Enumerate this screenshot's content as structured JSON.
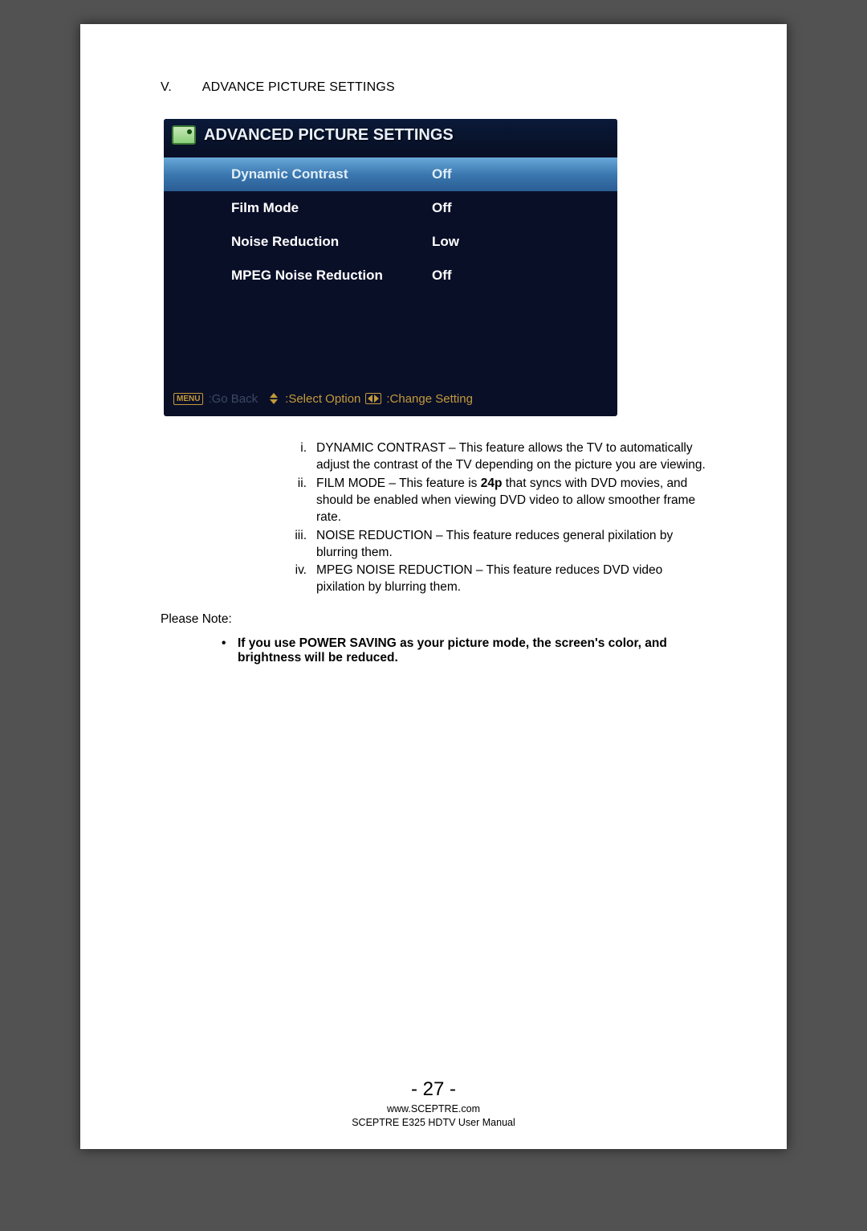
{
  "section": {
    "number": "V.",
    "title": "ADVANCE PICTURE SETTINGS"
  },
  "osd": {
    "title": "ADVANCED PICTURE SETTINGS",
    "rows": [
      {
        "label": "Dynamic Contrast",
        "value": "Off",
        "selected": true
      },
      {
        "label": "Film Mode",
        "value": "Off",
        "selected": false
      },
      {
        "label": "Noise Reduction",
        "value": "Low",
        "selected": false
      },
      {
        "label": "MPEG Noise Reduction",
        "value": "Off",
        "selected": false
      }
    ],
    "footer": {
      "menu_badge": "MENU",
      "go_back": ":Go Back",
      "select_option": ":Select Option",
      "change_setting": ":Change Setting"
    }
  },
  "descriptions": [
    {
      "roman": "i.",
      "text": "DYNAMIC CONTRAST – This feature allows the TV to automatically adjust the contrast of the TV depending on the picture you are viewing."
    },
    {
      "roman": "ii.",
      "text_before": "FILM MODE – This feature is ",
      "bold": "24p",
      "text_after": " that syncs with DVD movies, and should be enabled when viewing DVD video to allow smoother frame rate."
    },
    {
      "roman": "iii.",
      "text": "NOISE REDUCTION – This feature reduces general pixilation by blurring them."
    },
    {
      "roman": "iv.",
      "text": "MPEG NOISE REDUCTION – This feature reduces DVD video pixilation by blurring them."
    }
  ],
  "please_note_label": "Please Note:",
  "note_bullet": "If you use POWER SAVING as your picture mode, the screen's color, and brightness will be reduced.",
  "page_number": "- 27 -",
  "footer": {
    "url": "www.SCEPTRE.com",
    "manual": "SCEPTRE E325 HDTV User Manual"
  }
}
